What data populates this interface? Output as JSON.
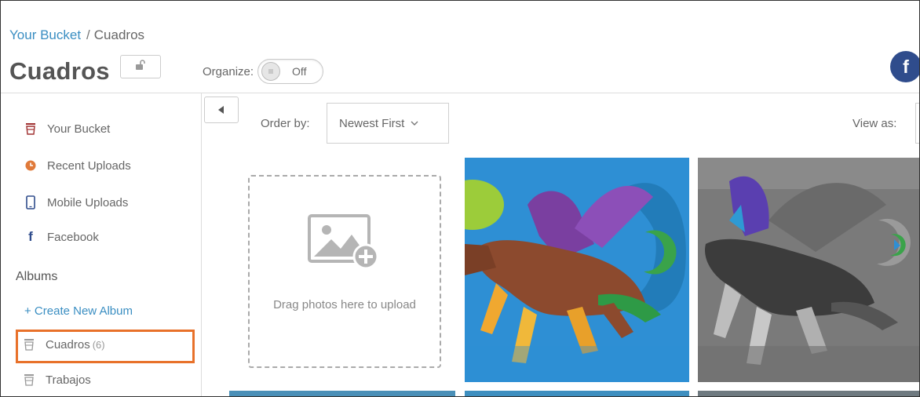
{
  "header": {
    "breadcrumb_root": "Your Bucket",
    "breadcrumb_separator": "/",
    "breadcrumb_current": "Cuadros",
    "title": "Cuadros",
    "organize_label": "Organize:",
    "organize_state": "Off",
    "social_icon": "facebook-icon"
  },
  "sidebar": {
    "items": [
      {
        "label": "Your Bucket",
        "icon": "bucket-icon"
      },
      {
        "label": "Recent Uploads",
        "icon": "clock-icon"
      },
      {
        "label": "Mobile Uploads",
        "icon": "phone-icon"
      },
      {
        "label": "Facebook",
        "icon": "facebook-icon"
      }
    ],
    "albums_heading": "Albums",
    "create_album": "+ Create New Album",
    "albums": [
      {
        "label": "Cuadros",
        "count": "(6)",
        "selected": true
      },
      {
        "label": "Trabajos",
        "count": "",
        "selected": false
      }
    ]
  },
  "toolbar": {
    "order_label": "Order by:",
    "order_value": "Newest First",
    "view_label": "View as:"
  },
  "dropzone": {
    "text": "Drag photos here to upload"
  },
  "colors": {
    "link": "#3a8ec2",
    "highlight": "#e8712a",
    "facebook": "#2f4c8c"
  }
}
